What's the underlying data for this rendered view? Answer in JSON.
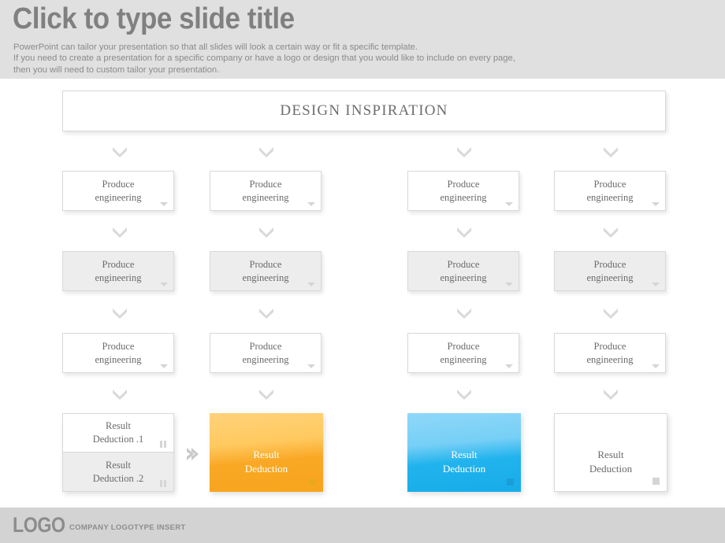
{
  "header": {
    "title": "Click to type slide title",
    "subtitle_lines": [
      "PowerPoint can tailor your presentation so that all slides will look a certain way or fit a specific template.",
      "If you need to create a presentation for a specific company or have a logo or design that you would like to include on every page,",
      "then you will need to custom tailor your presentation."
    ],
    "background_color": "#e0e0e0",
    "title_color": "#808080"
  },
  "banner": {
    "label": "DESIGN  INSPIRATION"
  },
  "process": {
    "box_label_line1": "Produce",
    "box_label_line2": "engineering",
    "marker_icon": "triangle-down-icon",
    "connector_icon": "chevron-down-icon",
    "rows": [
      {
        "fill": "white",
        "boxes": [
          "Produce engineering",
          "Produce engineering",
          "Produce engineering",
          "Produce engineering"
        ]
      },
      {
        "fill": "grey",
        "boxes": [
          "Produce engineering",
          "Produce engineering",
          "Produce engineering",
          "Produce engineering"
        ]
      },
      {
        "fill": "white",
        "boxes": [
          "Produce engineering",
          "Produce engineering",
          "Produce engineering",
          "Produce engineering"
        ]
      }
    ]
  },
  "results": {
    "stack": {
      "top_line1": "Result",
      "top_line2": "Deduction .1",
      "bottom_line1": "Result",
      "bottom_line2": "Deduction .2",
      "marker_icon": "pause-bars-icon"
    },
    "arrow_icon": "chevron-right-icon",
    "orange": {
      "line1": "Result",
      "line2": "Deduction",
      "color": "#f9a825",
      "marker_icon": "square-marker-icon"
    },
    "blue": {
      "line1": "Result",
      "line2": "Deduction",
      "color": "#21b3ed",
      "marker_icon": "square-marker-icon"
    },
    "plain": {
      "line1": "Result",
      "line2": "Deduction",
      "color": "#ffffff",
      "marker_icon": "square-marker-icon"
    }
  },
  "footer": {
    "logo_text": "LOGO",
    "caption": "COMPANY LOGOTYPE INSERT",
    "background_color": "#d3d3d3"
  }
}
